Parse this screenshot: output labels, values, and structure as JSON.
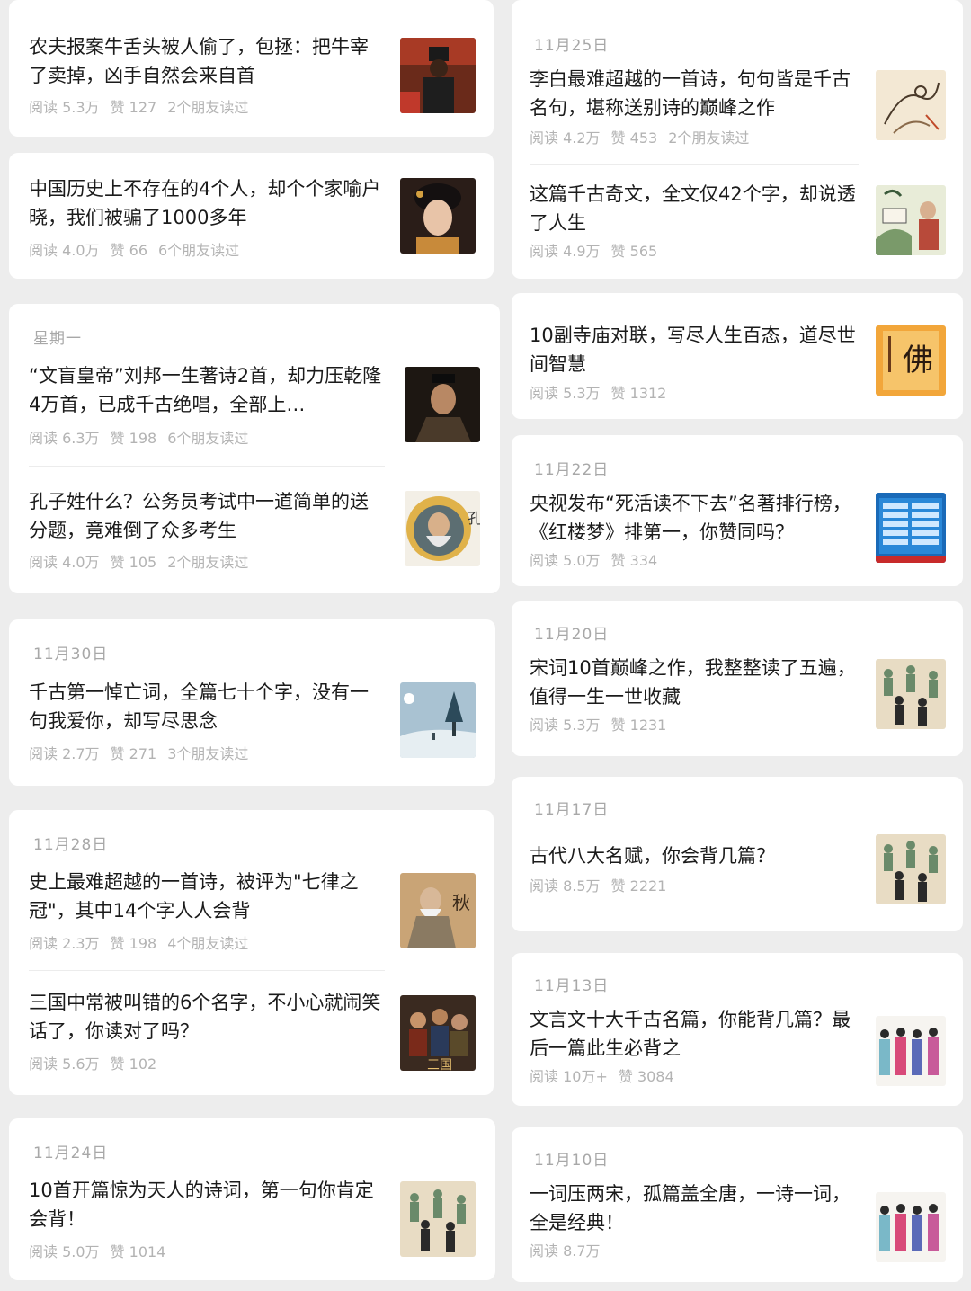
{
  "left": [
    {
      "date": "",
      "items": [
        {
          "title": "农夫报案牛舌头被人偷了，包拯：把牛宰了卖掉，凶手自然会来自首",
          "read": "阅读 5.3万",
          "like": "赞 127",
          "friends": "2个朋友读过",
          "thumb": "bao-zheng-thumbnail"
        }
      ]
    },
    {
      "date": "",
      "items": [
        {
          "title": "中国历史上不存在的4个人，却个个家喻户晓，我们被骗了1000多年",
          "read": "阅读 4.0万",
          "like": "赞 66",
          "friends": "6个朋友读过",
          "thumb": "lady-portrait-thumbnail"
        }
      ]
    },
    {
      "date": "星期一",
      "items": [
        {
          "title": "“文盲皇帝”刘邦一生著诗2首，却力压乾隆4万首，已成千古绝唱，全部上…",
          "read": "阅读 6.3万",
          "like": "赞 198",
          "friends": "6个朋友读过",
          "thumb": "emperor-thumbnail"
        },
        {
          "title": "孔子姓什么？公务员考试中一道简单的送分题，竟难倒了众多考生",
          "read": "阅读 4.0万",
          "like": "赞 105",
          "friends": "2个朋友读过",
          "thumb": "confucius-thumbnail"
        }
      ]
    },
    {
      "date": "11月30日",
      "items": [
        {
          "title": "千古第一悼亡词，全篇七十个字，没有一句我爱你，却写尽思念",
          "read": "阅读 2.7万",
          "like": "赞 271",
          "friends": "3个朋友读过",
          "thumb": "snow-landscape-thumbnail"
        }
      ]
    },
    {
      "date": "11月28日",
      "items": [
        {
          "title": "史上最难超越的一首诗，被评为\"七律之冠\"，其中14个字人人会背",
          "read": "阅读 2.3万",
          "like": "赞 198",
          "friends": "4个朋友读过",
          "thumb": "old-poet-thumbnail"
        },
        {
          "title": "三国中常被叫错的6个名字，不小心就闹笑话了，你读对了吗？",
          "read": "阅读 5.6万",
          "like": "赞 102",
          "friends": "",
          "thumb": "three-kingdoms-thumbnail"
        }
      ]
    },
    {
      "date": "11月24日",
      "items": [
        {
          "title": "10首开篇惊为天人的诗词，第一句你肯定会背！",
          "read": "阅读 5.0万",
          "like": "赞 1014",
          "friends": "",
          "thumb": "figures-thumbnail"
        }
      ]
    }
  ],
  "right": [
    {
      "date": "11月25日",
      "items": [
        {
          "title": "李白最难超越的一首诗，句句皆是千古名句，堪称送别诗的巅峰之作",
          "read": "阅读 4.2万",
          "like": "赞 453",
          "friends": "2个朋友读过",
          "thumb": "ink-sketch-thumbnail"
        },
        {
          "title": "这篇千古奇文，全文仅42个字，却说透了人生",
          "read": "阅读 4.9万",
          "like": "赞 565",
          "friends": "",
          "thumb": "scholar-painting-thumbnail"
        }
      ]
    },
    {
      "date": "",
      "items": [
        {
          "title": "10副寺庙对联，写尽人生百态，道尽世间智慧",
          "read": "阅读 5.3万",
          "like": "赞 1312",
          "friends": "",
          "thumb": "calligraphy-thumbnail"
        }
      ]
    },
    {
      "date": "11月22日",
      "items": [
        {
          "title": "央视发布“死活读不下去”名著排行榜，《红楼梦》排第一，你赞同吗？",
          "read": "阅读 5.0万",
          "like": "赞 334",
          "friends": "",
          "thumb": "tv-screen-thumbnail"
        }
      ]
    },
    {
      "date": "11月20日",
      "items": [
        {
          "title": "宋词10首巅峰之作，我整整读了五遍，值得一生一世收藏",
          "read": "阅读 5.3万",
          "like": "赞 1231",
          "friends": "",
          "thumb": "figures-thumbnail"
        }
      ]
    },
    {
      "date": "11月17日",
      "items": [
        {
          "title": "古代八大名赋，你会背几篇？",
          "read": "阅读 8.5万",
          "like": "赞 2221",
          "friends": "",
          "thumb": "figures-thumbnail"
        }
      ]
    },
    {
      "date": "11月13日",
      "items": [
        {
          "title": "文言文十大千古名篇，你能背几篇？最后一篇此生必背之",
          "read": "阅读 10万+",
          "like": "赞 3084",
          "friends": "",
          "thumb": "colorful-figures-thumbnail"
        }
      ]
    },
    {
      "date": "11月10日",
      "items": [
        {
          "title": "一词压两宋，孤篇盖全唐，一诗一词，全是经典！",
          "read": "阅读 8.7万",
          "like": "",
          "friends": "",
          "thumb": "colorful-figures-thumbnail"
        }
      ]
    }
  ]
}
